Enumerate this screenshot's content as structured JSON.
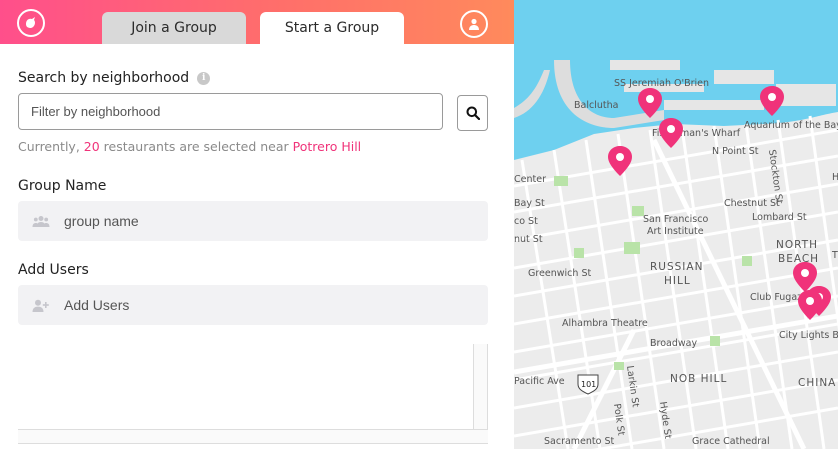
{
  "header": {
    "tabs": [
      {
        "label": "Join a Group",
        "active": false
      },
      {
        "label": "Start a Group",
        "active": true
      }
    ],
    "colors": {
      "gradient_start": "#ff4f8b",
      "gradient_end": "#ff8a5c"
    }
  },
  "search": {
    "label": "Search by neighborhood",
    "placeholder": "Filter by neighborhood",
    "value": ""
  },
  "status": {
    "prefix": "Currently,",
    "count": "20",
    "middle": "restaurants are selected near",
    "neighborhood": "Potrero Hill"
  },
  "group_name": {
    "label": "Group Name",
    "placeholder": "group name",
    "value": ""
  },
  "add_users": {
    "label": "Add Users",
    "placeholder": "Add Users",
    "value": ""
  },
  "map": {
    "labels": {
      "jeremiah": "SS Jeremiah O'Brien",
      "balclutha": "Balclutha",
      "wharf": "Fisherman's Wharf",
      "aquarium": "Aquarium of the Bay",
      "npoint": "N Point St",
      "stockton": "Stockton St",
      "center": "Center",
      "bay": "Bay St",
      "sfai": "San Francisco Art Institute",
      "chestnut": "Chestnut St",
      "lombard": "Lombard St",
      "northbeach": "NORTH BEACH",
      "russianhill": "RUSSIAN HILL",
      "greenwich": "Greenwich St",
      "clubfugazi": "Club Fugazi",
      "alhambra": "Alhambra Theatre",
      "broadway": "Broadway",
      "citylights": "City Lights Bo",
      "pacific": "Pacific Ave",
      "route": "101",
      "larkin": "Larkin St",
      "nobhill": "NOB HILL",
      "china": "CHINA",
      "polk": "Polk St",
      "hyde": "Hyde St",
      "sacramento": "Sacramento St",
      "grace": "Grace Cathedral",
      "h": "H",
      "t": "T",
      "co": "co St",
      "nut": "nut St"
    },
    "pin_color": "#f0337a",
    "water_color": "#6ed0ef"
  }
}
